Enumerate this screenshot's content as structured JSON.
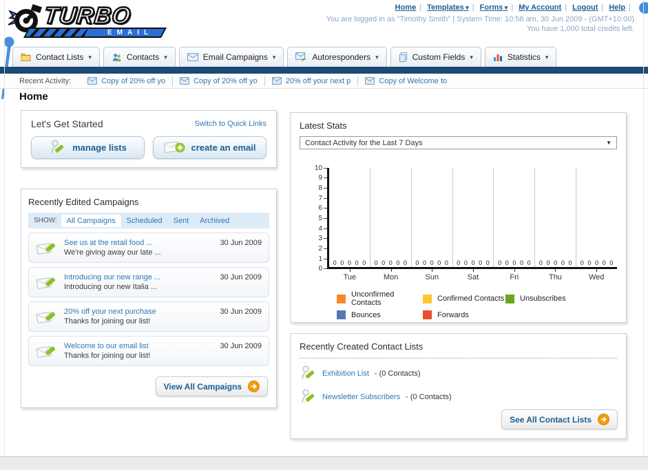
{
  "logo": {
    "line1": "TURBO",
    "line2": "EMAIL"
  },
  "header": {
    "nav_links": [
      {
        "label": "Home",
        "dropdown": false
      },
      {
        "label": "Templates",
        "dropdown": true
      },
      {
        "label": "Forms",
        "dropdown": true
      },
      {
        "label": "My Account",
        "dropdown": false
      },
      {
        "label": "Logout",
        "dropdown": false
      },
      {
        "label": "Help",
        "dropdown": false
      }
    ],
    "status_line1": "You are logged in as \"Timothy Smith\" | System Time: 10:58 am, 30 Jun 2009 - (GMT+10:00)",
    "status_line2": "You have 1,000 total credits left."
  },
  "nav_tabs": [
    {
      "label": "Contact Lists",
      "icon": "folder"
    },
    {
      "label": "Contacts",
      "icon": "people"
    },
    {
      "label": "Email Campaigns",
      "icon": "envelope"
    },
    {
      "label": "Autoresponders",
      "icon": "envelope-arrow"
    },
    {
      "label": "Custom Fields",
      "icon": "pages"
    },
    {
      "label": "Statistics",
      "icon": "bar-chart"
    }
  ],
  "recent_activity": {
    "label": "Recent Activity:",
    "items": [
      {
        "label": "Copy of 20% off yo",
        "icon": "envelope-small"
      },
      {
        "label": "Copy of 20% off yo",
        "icon": "envelope-small"
      },
      {
        "label": "20% off your next p",
        "icon": "envelope-small"
      },
      {
        "label": "Copy of Welcome to",
        "icon": "envelope-small"
      }
    ]
  },
  "page_title": "Home",
  "get_started": {
    "title": "Let's Get Started",
    "switch_link": "Switch to Quick Links",
    "buttons": [
      {
        "label": "manage lists",
        "icon": "person-pencil"
      },
      {
        "label": "create an email",
        "icon": "envelope-plus"
      }
    ]
  },
  "campaigns": {
    "title": "Recently Edited Campaigns",
    "show_label": "SHOW:",
    "filters": [
      {
        "label": "All Campaigns",
        "active": true
      },
      {
        "label": "Scheduled",
        "active": false
      },
      {
        "label": "Sent",
        "active": false
      },
      {
        "label": "Archived",
        "active": false
      }
    ],
    "items": [
      {
        "title": "See us at the retail food ...",
        "subtitle": "We're giving away our late ...",
        "date": "30 Jun 2009",
        "icon": "envelope-pencil"
      },
      {
        "title": "Introducing our new range ...",
        "subtitle": "Introducing our new Italia ...",
        "date": "30 Jun 2009",
        "icon": "envelope-pencil"
      },
      {
        "title": "20% off your next purchase",
        "subtitle": "Thanks for joining our list!",
        "date": "30 Jun 2009",
        "icon": "envelope-pencil"
      },
      {
        "title": "Welcome to our email list",
        "subtitle": "Thanks for joining our list!",
        "date": "30 Jun 2009",
        "icon": "envelope-pencil"
      }
    ],
    "view_all": {
      "label": "View All Campaigns",
      "icon": "arrow-circle"
    }
  },
  "latest_stats": {
    "title": "Latest Stats",
    "dropdown_value": "Contact Activity for the Last 7 Days",
    "chart_data": {
      "type": "bar",
      "title": "Contact Activity for the Last 7 Days",
      "categories": [
        "Tue",
        "Mon",
        "Sun",
        "Sat",
        "Fri",
        "Thu",
        "Wed"
      ],
      "series": [
        {
          "name": "Unconfirmed Contacts",
          "color": "#f6882c",
          "values": [
            0,
            0,
            0,
            0,
            0,
            0,
            0
          ]
        },
        {
          "name": "Confirmed Contacts",
          "color": "#fdc62f",
          "values": [
            0,
            0,
            0,
            0,
            0,
            0,
            0
          ]
        },
        {
          "name": "Unsubscribes",
          "color": "#69a61f",
          "values": [
            0,
            0,
            0,
            0,
            0,
            0,
            0
          ]
        },
        {
          "name": "Bounces",
          "color": "#5a77b4",
          "values": [
            0,
            0,
            0,
            0,
            0,
            0,
            0
          ]
        },
        {
          "name": "Forwards",
          "color": "#e8502c",
          "values": [
            0,
            0,
            0,
            0,
            0,
            0,
            0
          ]
        }
      ],
      "ylim": [
        0,
        10
      ],
      "yticks": [
        10,
        9,
        8,
        7,
        6,
        5,
        4,
        3,
        2,
        1,
        0
      ],
      "grid": "vertical-only",
      "legend_position": "bottom"
    }
  },
  "contact_lists": {
    "title": "Recently Created Contact Lists",
    "items": [
      {
        "name": "Exhibition List",
        "detail": "- (0 Contacts)",
        "icon": "person-pencil"
      },
      {
        "name": "Newsletter Subscribers",
        "detail": "- (0 Contacts)",
        "icon": "person-pencil"
      }
    ],
    "see_all": {
      "label": "See All Contact Lists",
      "icon": "arrow-circle"
    }
  }
}
